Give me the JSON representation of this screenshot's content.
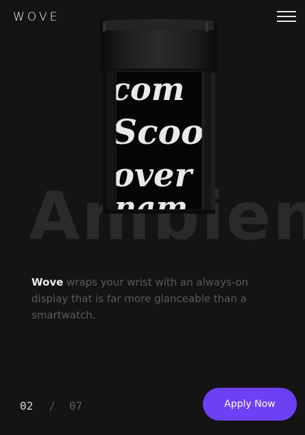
{
  "header": {
    "logo": "WOVE"
  },
  "hero": {
    "watermark": "Ambient",
    "description_brand": "Wove",
    "description_text": " wraps your wrist with an always-on display that is far more glanceable than a smartwatch.",
    "screen_words": [
      "com",
      "Scoot",
      "over"
    ]
  },
  "pager": {
    "current": "02",
    "separator": "/",
    "total": "07"
  },
  "cta": {
    "label": "Apply Now"
  },
  "colors": {
    "background": "#141414",
    "accent": "#6d3ff5"
  }
}
